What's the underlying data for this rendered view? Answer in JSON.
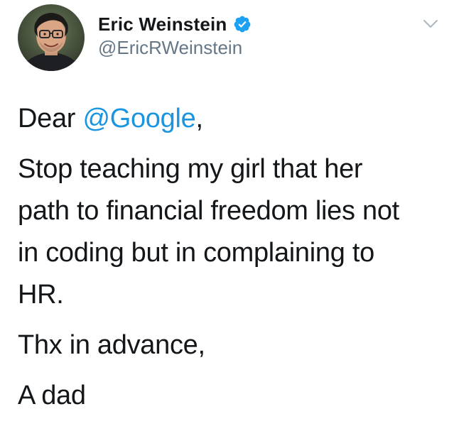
{
  "author": {
    "display_name": "Eric Weinstein",
    "handle": "@EricRWeinstein",
    "verified": true,
    "avatar_icon": "profile-photo"
  },
  "menu": {
    "icon": "chevron-down-icon"
  },
  "tweet": {
    "salutation_prefix": "Dear ",
    "salutation_mention": "@Google",
    "salutation_suffix": ",",
    "lines": [
      "Stop teaching my girl that her",
      "path to financial freedom lies not",
      "in coding but in complaining to",
      "HR."
    ],
    "closing": "Thx in advance,",
    "signature": "A dad"
  },
  "colors": {
    "text": "#14171a",
    "handle": "#657786",
    "mention": "#1b95e0",
    "verified_badge": "#1da1f2",
    "chevron": "#aab8c2"
  }
}
